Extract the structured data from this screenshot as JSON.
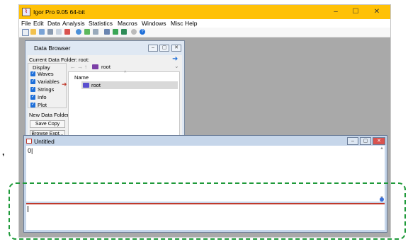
{
  "app": {
    "title": "Igor Pro 9.05 64-bit",
    "icon": "igor-app-icon"
  },
  "window_controls": {
    "minimize": "–",
    "maximize": "☐",
    "close": "✕"
  },
  "menubar": [
    "File",
    "Edit",
    "Data",
    "Analysis",
    "Statistics",
    "Macros",
    "Windows",
    "Misc",
    "Help"
  ],
  "data_browser": {
    "title": "Data Browser",
    "current_folder_label": "Current Data Folder:",
    "current_folder_value": "root:",
    "display_label": "Display",
    "checkboxes": [
      "Waves",
      "Variables",
      "Strings",
      "Info",
      "Plot"
    ],
    "path_folder": "root",
    "name_header": "Name",
    "tree_item": "root",
    "buttons": {
      "new_folder": "New Data Folder",
      "save_copy": "Save Copy",
      "browse": "Browse Expt..."
    }
  },
  "command_window": {
    "title": "Untitled",
    "history_text": "0|"
  },
  "colors": {
    "titlebar": "#ffc107",
    "highlight": "#1f9a3a",
    "separator": "#c0392b"
  }
}
